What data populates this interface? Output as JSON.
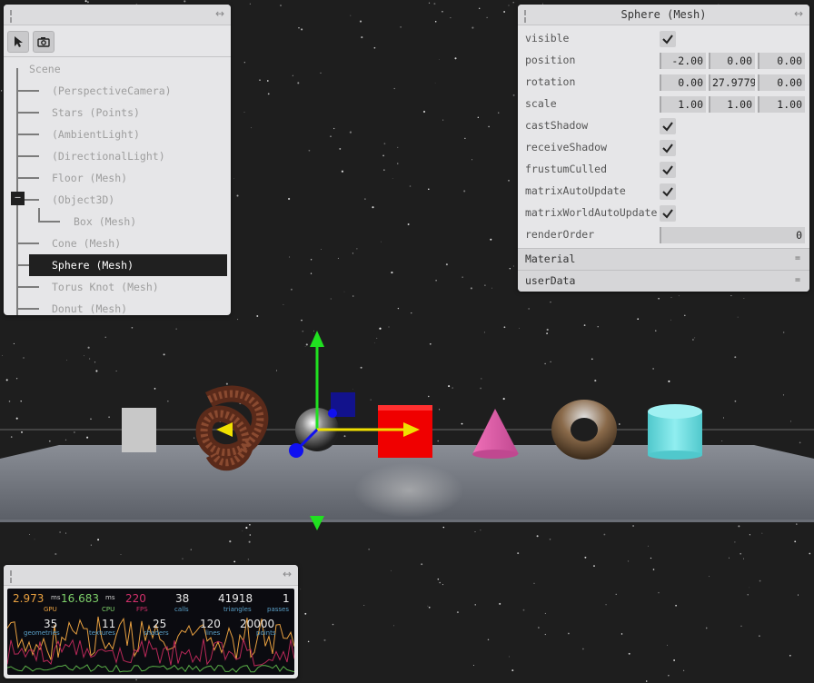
{
  "outliner": {
    "tools": [
      {
        "icon": "pointer-icon"
      },
      {
        "icon": "camera-icon"
      }
    ],
    "root_label": "Scene",
    "items": [
      {
        "label": "(PerspectiveCamera)",
        "selected": false
      },
      {
        "label": "Stars (Points)",
        "selected": false
      },
      {
        "label": "(AmbientLight)",
        "selected": false
      },
      {
        "label": "(DirectionalLight)",
        "selected": false
      },
      {
        "label": "Floor (Mesh)",
        "selected": false
      },
      {
        "label": "(Object3D)",
        "selected": false,
        "collapse_symbol": "–"
      },
      {
        "label": "Box (Mesh)",
        "selected": false
      },
      {
        "label": "Cone (Mesh)",
        "selected": false
      },
      {
        "label": "Sphere (Mesh)",
        "selected": true
      },
      {
        "label": "Torus Knot (Mesh)",
        "selected": false
      },
      {
        "label": "Donut (Mesh)",
        "selected": false
      }
    ]
  },
  "props": {
    "title": "Sphere (Mesh)",
    "rows": [
      {
        "label": "visible",
        "type": "bool",
        "value": true
      },
      {
        "label": "position",
        "type": "vec3",
        "values": [
          "-2.00",
          "0.00",
          "0.00"
        ]
      },
      {
        "label": "rotation",
        "type": "vec3",
        "values": [
          "0.00",
          "27.9779",
          "0.00"
        ]
      },
      {
        "label": "scale",
        "type": "vec3",
        "values": [
          "1.00",
          "1.00",
          "1.00"
        ]
      },
      {
        "label": "castShadow",
        "type": "bool",
        "value": true
      },
      {
        "label": "receiveShadow",
        "type": "bool",
        "value": true
      },
      {
        "label": "frustumCulled",
        "type": "bool",
        "value": true
      },
      {
        "label": "matrixAutoUpdate",
        "type": "bool",
        "value": true
      },
      {
        "label": "matrixWorldAutoUpdate",
        "type": "bool",
        "value": true
      },
      {
        "label": "renderOrder",
        "type": "num",
        "value": "0"
      }
    ],
    "sections": [
      {
        "label": "Material",
        "symbol": "="
      },
      {
        "label": "userData",
        "symbol": "="
      }
    ]
  },
  "stats": {
    "gpu": {
      "value": "2.973",
      "unit": "ms",
      "label": "GPU",
      "color": "#e8a040"
    },
    "cpu": {
      "value": "16.683",
      "unit": "ms",
      "label": "CPU",
      "color": "#7ed06a"
    },
    "fps": {
      "value": "220",
      "label": "FPS",
      "color": "#d0306a"
    },
    "calls": {
      "value": "38",
      "label": "calls"
    },
    "triangles": {
      "value": "41918",
      "label": "triangles"
    },
    "passes": {
      "value": "1",
      "label": "passes"
    },
    "geometries": {
      "value": "35",
      "label": "geometries"
    },
    "textures": {
      "value": "11",
      "label": "textures"
    },
    "shaders": {
      "value": "25",
      "label": "shaders"
    },
    "lines": {
      "value": "120",
      "label": "lines"
    },
    "points": {
      "value": "20000",
      "label": "points"
    }
  },
  "scene": {
    "background": "#1e1e1e",
    "objects": [
      "plane",
      "torus-knot",
      "sphere",
      "box",
      "cone",
      "donut",
      "cylinder"
    ],
    "box_color": "#f00000",
    "cone_color": "#e060a8",
    "cylinder_color": "#70d8dc",
    "gizmo_x_color": "#f0e000",
    "gizmo_y_color": "#20e020",
    "gizmo_z_color": "#1010f0"
  }
}
